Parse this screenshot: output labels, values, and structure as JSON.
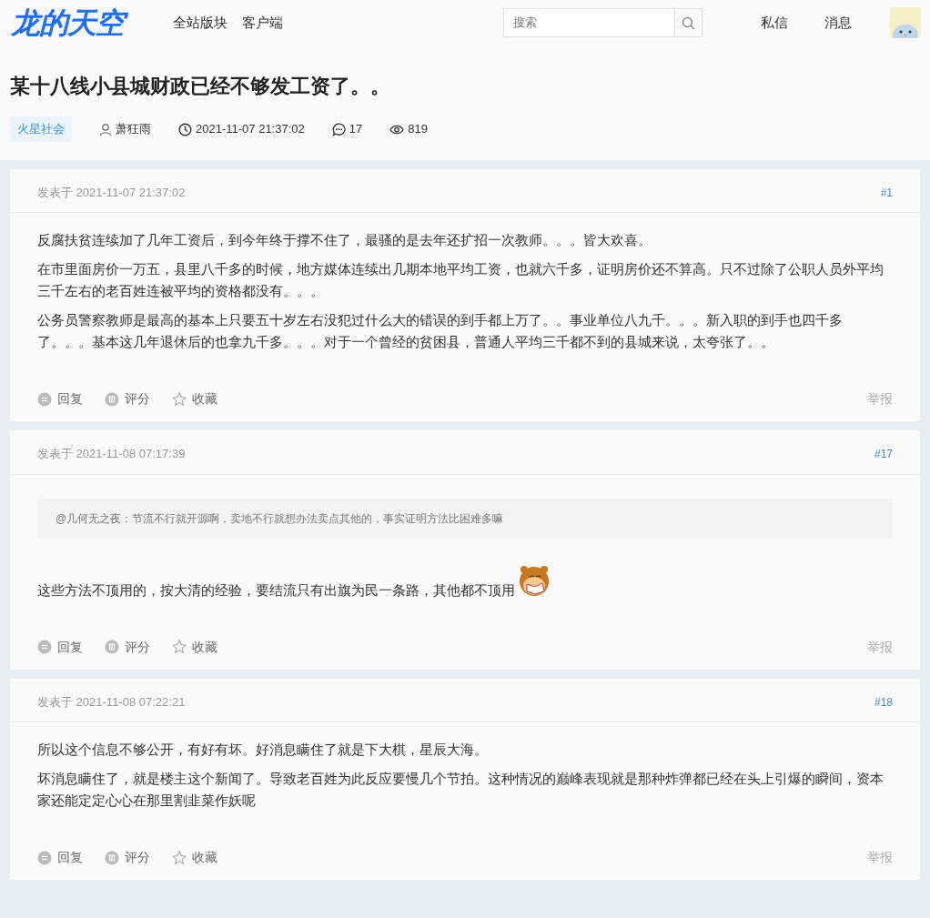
{
  "logo": "龙的天空",
  "nav": [
    {
      "label": "全站版块"
    },
    {
      "label": "客户端"
    }
  ],
  "search": {
    "placeholder": "搜索"
  },
  "user_links": [
    {
      "label": "私信"
    },
    {
      "label": "消息"
    }
  ],
  "thread": {
    "title": "某十八线小县城财政已经不够发工资了。。",
    "tag": "火星社会",
    "author": "萧狂雨",
    "time": "2021-11-07 21:37:02",
    "replies": "17",
    "views": "819"
  },
  "posts": [
    {
      "posted": "发表于 2021-11-07 21:37:02",
      "floor": "#1",
      "paragraphs": [
        {
          "text": "反腐扶贫连续加了几年工资后，到今年终于撑不住了，最骚的是去年还扩招一次教师。。。皆大欢喜。",
          "sticker": false
        },
        {
          "text": "在市里面房价一万五，县里八千多的时候，地方媒体连续出几期本地平均工资，也就六千多，证明房价还不算高。只不过除了公职人员外平均三千左右的老百姓连被平均的资格都没有。。。",
          "sticker": false
        },
        {
          "text": "公务员警察教师是最高的基本上只要五十岁左右没犯过什么大的错误的到手都上万了。。事业单位八九千。。。新入职的到手也四千多了。。。基本这几年退休后的也拿九千多。。。对于一个曾经的贫困县，普通人平均三千都不到的县城来说，太夸张了。。",
          "sticker": false
        }
      ],
      "actions": [
        {
          "kind": "reply",
          "label": "回复"
        },
        {
          "kind": "rate",
          "label": "评分"
        },
        {
          "kind": "favorite",
          "label": "收藏"
        }
      ],
      "report": "举报"
    },
    {
      "posted": "发表于 2021-11-08 07:17:39",
      "floor": "#17",
      "quote": {
        "user": "@几何无之夜",
        "text": "：节流不行就开源啊，卖地不行就想办法卖点其他的，事实证明方法比困难多嘛"
      },
      "paragraphs": [
        {
          "text": "这些方法不顶用的，按大清的经验，要结流只有出旗为民一条路，其他都不顶用",
          "sticker": true
        }
      ],
      "actions": [
        {
          "kind": "reply",
          "label": "回复"
        },
        {
          "kind": "rate",
          "label": "评分"
        },
        {
          "kind": "favorite",
          "label": "收藏"
        }
      ],
      "report": "举报"
    },
    {
      "posted": "发表于 2021-11-08 07:22:21",
      "floor": "#18",
      "paragraphs": [
        {
          "text": "所以这个信息不够公开，有好有坏。好消息瞒住了就是下大棋，星辰大海。",
          "sticker": false
        },
        {
          "text": "坏消息瞒住了，就是楼主这个新闻了。导致老百姓为此反应要慢几个节拍。这种情况的巅峰表现就是那种炸弹都已经在头上引爆的瞬间，资本家还能定定心心在那里割韭菜作妖呢",
          "sticker": false
        }
      ],
      "actions": [
        {
          "kind": "reply",
          "label": "回复"
        },
        {
          "kind": "rate",
          "label": "评分"
        },
        {
          "kind": "favorite",
          "label": "收藏"
        }
      ],
      "report": "举报"
    }
  ]
}
